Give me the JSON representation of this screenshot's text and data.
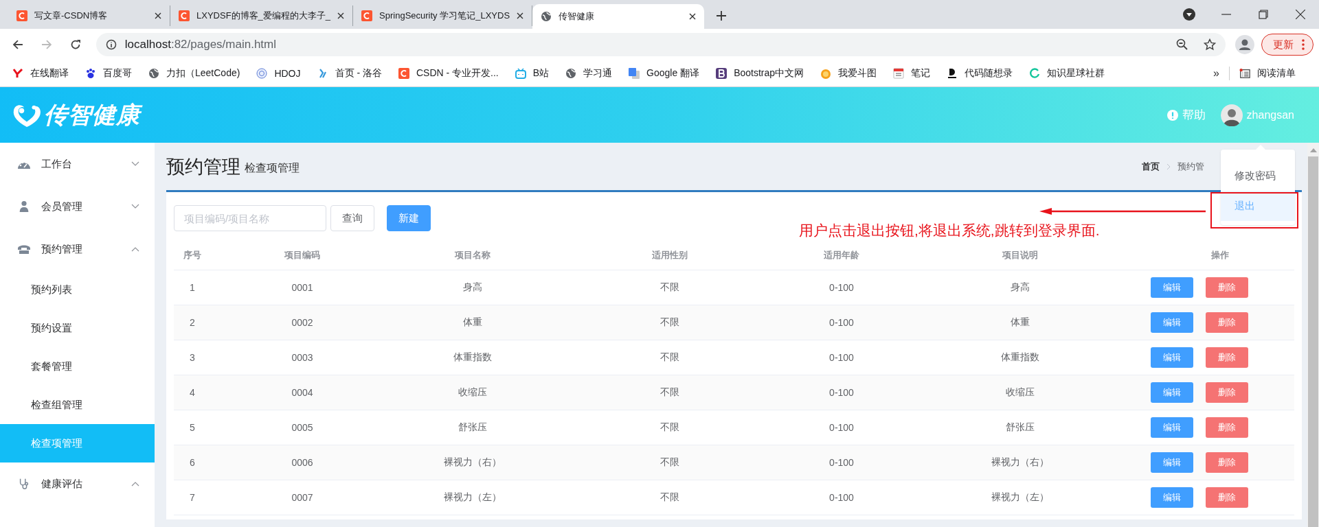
{
  "browser": {
    "tabs": [
      {
        "title": "写文章-CSDN博客",
        "kind": "csdn",
        "selected": false
      },
      {
        "title": "LXYDSF的博客_爱编程的大李子_",
        "kind": "csdn",
        "selected": false
      },
      {
        "title": "SpringSecurity 学习笔记_LXYDS",
        "kind": "csdn",
        "selected": false
      },
      {
        "title": "传智健康",
        "kind": "globe",
        "selected": true
      }
    ],
    "address": {
      "host": "localhost",
      "rest": ":82/pages/main.html"
    },
    "update_button": "更新",
    "bookmarks": [
      {
        "label": "在线翻译",
        "kind": "y"
      },
      {
        "label": "百度哥",
        "kind": "paw"
      },
      {
        "label": "力扣（LeetCode)",
        "kind": "globe"
      },
      {
        "label": "HDOJ",
        "kind": "seal"
      },
      {
        "label": "首页 - 洛谷",
        "kind": "luogu"
      },
      {
        "label": "CSDN - 专业开发...",
        "kind": "csdn"
      },
      {
        "label": "B站",
        "kind": "tv"
      },
      {
        "label": "学习通",
        "kind": "globe"
      },
      {
        "label": "Google 翻译",
        "kind": "translate"
      },
      {
        "label": "Bootstrap中文网",
        "kind": "bootstrap"
      },
      {
        "label": "我爱斗图",
        "kind": "orange"
      },
      {
        "label": "笔记",
        "kind": "calendar"
      },
      {
        "label": "代码随想录",
        "kind": "d"
      },
      {
        "label": "知识星球社群",
        "kind": "ring"
      }
    ],
    "bookmarks_more": "»",
    "reading_list": "阅读清单"
  },
  "app": {
    "logo": "传智健康",
    "help": "帮助",
    "user": "zhangsan",
    "user_menu": [
      {
        "label": "修改密码",
        "selected": false
      },
      {
        "label": "退出",
        "selected": true
      }
    ]
  },
  "sidebar": {
    "items": [
      {
        "label": "工作台",
        "expanded": false
      },
      {
        "label": "会员管理",
        "expanded": false
      },
      {
        "label": "预约管理",
        "expanded": true,
        "children": [
          {
            "label": "预约列表",
            "selected": false
          },
          {
            "label": "预约设置",
            "selected": false
          },
          {
            "label": "套餐管理",
            "selected": false
          },
          {
            "label": "检查组管理",
            "selected": false
          },
          {
            "label": "检查项管理",
            "selected": true
          }
        ]
      },
      {
        "label": "健康评估",
        "expanded": true
      }
    ]
  },
  "page": {
    "title": "预约管理",
    "subtitle": "检查项管理",
    "breadcrumb": [
      "首页",
      "预约管"
    ],
    "search": {
      "placeholder": "项目编码/项目名称"
    },
    "query_button": "查询",
    "new_button": "新建",
    "annotation": "用户点击退出按钮,将退出系统,跳转到登录界面.",
    "table": {
      "columns": [
        "序号",
        "项目编码",
        "项目名称",
        "适用性别",
        "适用年龄",
        "项目说明",
        "操作"
      ],
      "rows": [
        {
          "cells": [
            "1",
            "0001",
            "身高",
            "不限",
            "0-100",
            "身高"
          ],
          "actions": [
            "编辑",
            "删除"
          ]
        },
        {
          "cells": [
            "2",
            "0002",
            "体重",
            "不限",
            "0-100",
            "体重"
          ],
          "actions": [
            "编辑",
            "删除"
          ]
        },
        {
          "cells": [
            "3",
            "0003",
            "体重指数",
            "不限",
            "0-100",
            "体重指数"
          ],
          "actions": [
            "编辑",
            "删除"
          ]
        },
        {
          "cells": [
            "4",
            "0004",
            "收缩压",
            "不限",
            "0-100",
            "收缩压"
          ],
          "actions": [
            "编辑",
            "删除"
          ]
        },
        {
          "cells": [
            "5",
            "0005",
            "舒张压",
            "不限",
            "0-100",
            "舒张压"
          ],
          "actions": [
            "编辑",
            "删除"
          ]
        },
        {
          "cells": [
            "6",
            "0006",
            "裸视力（右）",
            "不限",
            "0-100",
            "裸视力（右）"
          ],
          "actions": [
            "编辑",
            "删除"
          ]
        },
        {
          "cells": [
            "7",
            "0007",
            "裸视力（左）",
            "不限",
            "0-100",
            "裸视力（左）"
          ],
          "actions": [
            "编辑",
            "删除"
          ]
        }
      ]
    }
  }
}
